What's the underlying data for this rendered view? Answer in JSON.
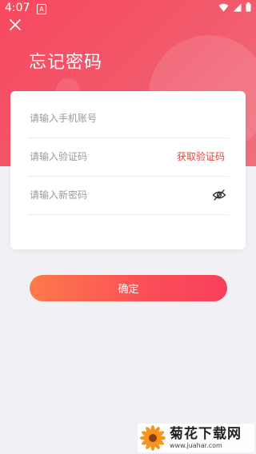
{
  "status_bar": {
    "time": "4:07",
    "notification_badge": "A"
  },
  "page": {
    "title": "忘记密码"
  },
  "form": {
    "phone_placeholder": "请输入手机账号",
    "code_placeholder": "请输入验证码",
    "get_code_label": "获取验证码",
    "password_placeholder": "请输入新密码"
  },
  "actions": {
    "confirm_label": "确定"
  },
  "watermark": {
    "name": "菊花下载网",
    "url": "www.juahar.com"
  },
  "colors": {
    "accent": "#f8485f",
    "link": "#e8443a",
    "button_start": "#fd7a4a",
    "button_end": "#f83f5c"
  }
}
